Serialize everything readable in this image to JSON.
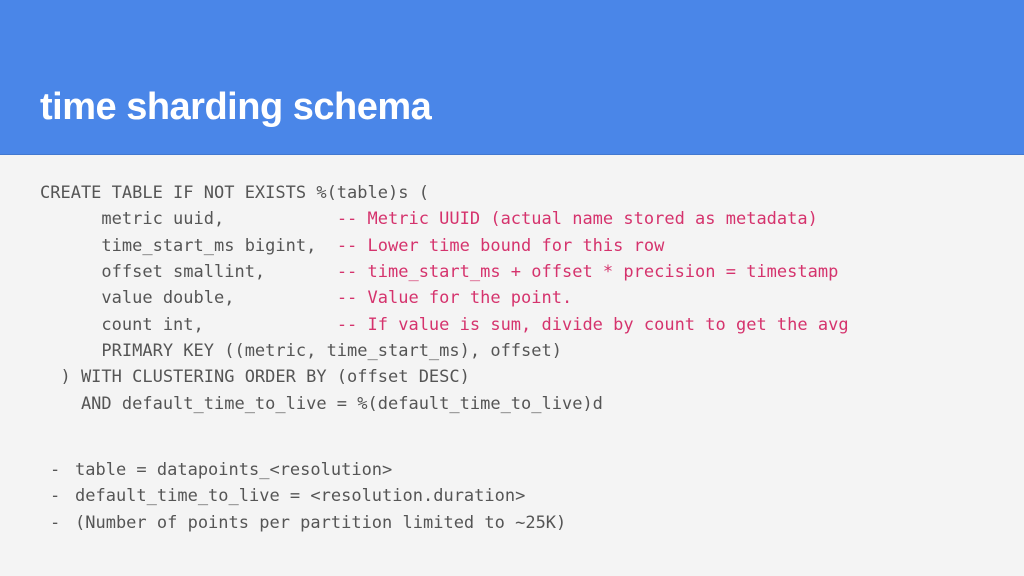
{
  "header": {
    "title": "time sharding schema"
  },
  "sql": {
    "l1": "CREATE TABLE IF NOT EXISTS %(table)s (",
    "l2a": "      metric uuid,           ",
    "l2b": "-- Metric UUID (actual name stored as metadata)",
    "l3a": "      time_start_ms bigint,  ",
    "l3b": "-- Lower time bound for this row",
    "l4a": "      offset smallint,       ",
    "l4b": "-- time_start_ms + offset * precision = timestamp",
    "l5a": "      value double,          ",
    "l5b": "-- Value for the point.",
    "l6a": "      count int,             ",
    "l6b": "-- If value is sum, divide by count to get the avg",
    "l7": "      PRIMARY KEY ((metric, time_start_ms), offset)",
    "l8": "  ) WITH CLUSTERING ORDER BY (offset DESC)",
    "l9": "    AND default_time_to_live = %(default_time_to_live)d"
  },
  "bullets": {
    "dash": "-",
    "b1": "table = datapoints_<resolution>",
    "b2": "default_time_to_live = <resolution.duration>",
    "b3": "(Number of points per partition limited to ~25K)"
  }
}
